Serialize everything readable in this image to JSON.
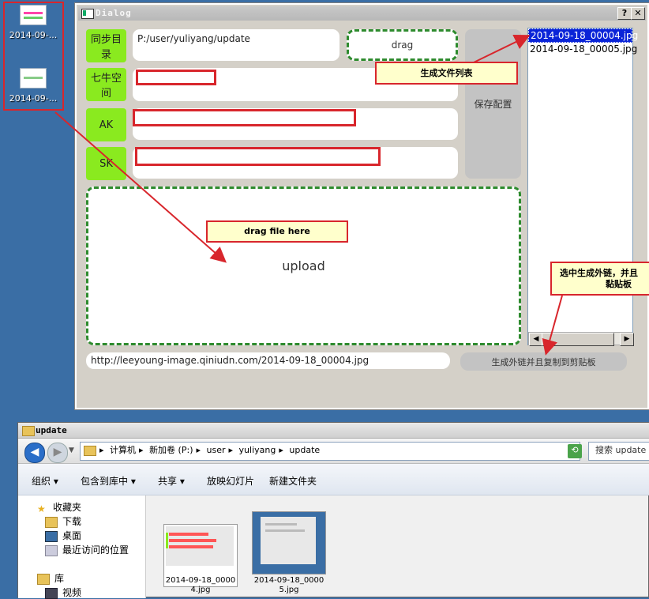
{
  "desktop": {
    "icons": [
      {
        "label": "2014-09-..."
      },
      {
        "label": "2014-09-..."
      }
    ]
  },
  "dialog": {
    "title": "Dialog",
    "help_btn": "?",
    "close_btn": "✕",
    "rows": [
      {
        "label": "同步目录",
        "value": "P:/user/yuliyang/update"
      },
      {
        "label": "七牛空间",
        "value": ""
      },
      {
        "label": "AK",
        "value": ""
      },
      {
        "label": "SK",
        "value": ""
      }
    ],
    "drag_label": "drag",
    "save_label": "保存配置",
    "files": [
      "2014-09-18_00004.jpg",
      "2014-09-18_00005.jpg"
    ],
    "selected_index": 0,
    "upload_label": "upload",
    "url_value": "http://leeyoung-image.qiniudn.com/2014-09-18_00004.jpg",
    "copy_label": "生成外链并且复制到剪贴板"
  },
  "callouts": {
    "filelist": "生成文件列表",
    "dragfile": "drag file here",
    "select_line1": "选中生成外链，并且",
    "select_line2": "黏贴板"
  },
  "explorer": {
    "title": "update",
    "breadcrumb": [
      "计算机",
      "新加卷 (P:)",
      "user",
      "yuliyang",
      "update"
    ],
    "search_placeholder": "搜索 update",
    "commands": [
      "组织 ▾",
      "包含到库中 ▾",
      "共享 ▾",
      "放映幻灯片",
      "新建文件夹"
    ],
    "nav": {
      "favorites": "收藏夹",
      "downloads": "下载",
      "desktop": "桌面",
      "recent": "最近访问的位置",
      "libraries": "库",
      "videos": "视频"
    },
    "files": [
      {
        "line1": "2014-09-18_0000",
        "line2": "4.jpg"
      },
      {
        "line1": "2014-09-18_0000",
        "line2": "5.jpg"
      }
    ]
  },
  "colors": {
    "accent_green": "#8aea1f",
    "annotation_red": "#d8262c",
    "selection_blue": "#0a24d8",
    "desktop_blue": "#3a6ea5"
  }
}
